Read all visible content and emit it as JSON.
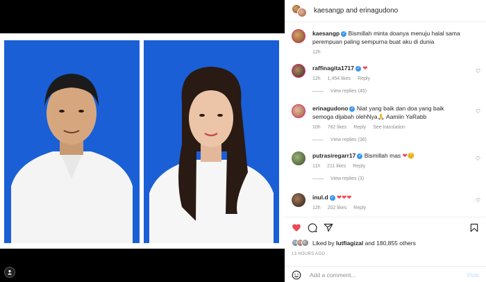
{
  "header": {
    "title": "kaesangp and erinagudono"
  },
  "caption": {
    "username": "kaesangp",
    "text": "Bismillah minta doanya menuju halal sama perempuan paling sempurna buat aku di dunia",
    "time": "12h"
  },
  "comments": [
    {
      "username": "raffinagita1717",
      "text": "",
      "emoji": "❤",
      "time": "12h",
      "likes": "1,454 likes",
      "reply": "Reply",
      "view_replies": "View replies (45)"
    },
    {
      "username": "erinagudono",
      "text": "Niat yang baik dan doa yang baik semoga dijabah olehNya🙏 Aamiin YaRabb",
      "time": "10h",
      "likes": "782 likes",
      "reply": "Reply",
      "translate": "See translation",
      "view_replies": "View replies (36)"
    },
    {
      "username": "putrasiregarr17",
      "text": "Bismillah mas",
      "emoji": "❤😊",
      "time": "11h",
      "likes": "211 likes",
      "reply": "Reply",
      "view_replies": "View replies (3)"
    },
    {
      "username": "inul.d",
      "text": "",
      "emoji": "❤❤❤",
      "time": "12h",
      "likes": "202 likes",
      "reply": "Reply"
    }
  ],
  "likes": {
    "text_prefix": "Liked by ",
    "user": "lutfiagizal",
    "text_suffix": " and 180,855 others"
  },
  "time_ago": "13 HOURS AGO",
  "add_comment": {
    "placeholder": "Add a comment...",
    "post_label": "Post"
  },
  "icons": {
    "tag": "person-tag-icon",
    "like": "heart-filled-icon",
    "comment": "comment-icon",
    "share": "share-icon",
    "save": "bookmark-icon",
    "emoji": "smiley-icon"
  },
  "colors": {
    "like_red": "#ed4956",
    "photo_bg": "#1a5fd6",
    "post_btn": "#b3dbff"
  }
}
